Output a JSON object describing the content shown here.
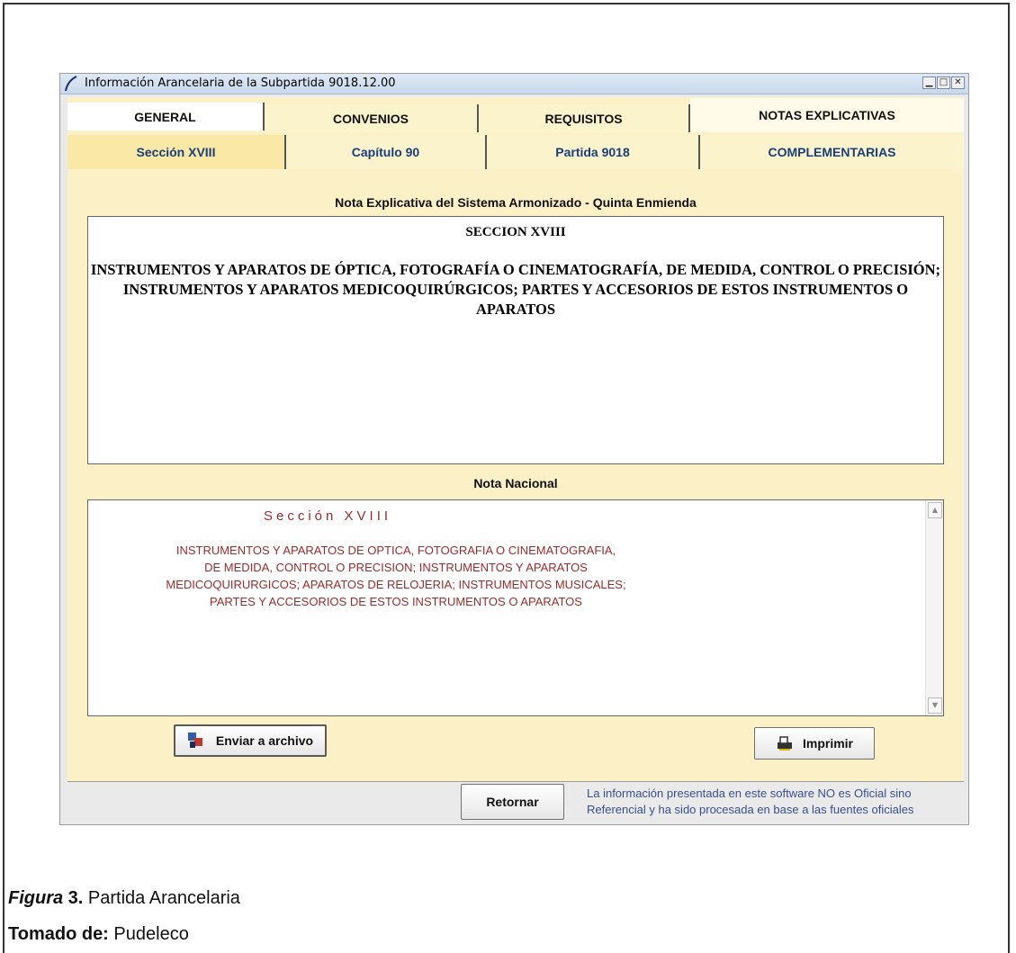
{
  "window": {
    "title": "Información Arancelaria de la Subpartida 9018.12.00",
    "controls": [
      "minimize",
      "maximize",
      "close"
    ]
  },
  "main_tabs": [
    {
      "label": "GENERAL",
      "active": false
    },
    {
      "label": "CONVENIOS",
      "active": false
    },
    {
      "label": "REQUISITOS",
      "active": false
    },
    {
      "label": "NOTAS EXPLICATIVAS",
      "active": true
    }
  ],
  "sub_tabs": [
    {
      "label": "Sección  XVIII",
      "active": true
    },
    {
      "label": "Capítulo  90",
      "active": false
    },
    {
      "label": "Partida  9018",
      "active": false
    },
    {
      "label": "COMPLEMENTARIAS",
      "active": false
    }
  ],
  "explicativa": {
    "header": "Nota Explicativa del Sistema Armonizado - Quinta Enmienda",
    "title": "SECCION XVIII",
    "lines": [
      "INSTRUMENTOS Y APARATOS DE ÓPTICA, FOTOGRAFÍA O CINEMATOGRAFÍA, DE MEDIDA,  CONTROL O PRECISIÓN;",
      "INSTRUMENTOS Y APARATOS MEDICOQUIRÚRGICOS;  PARTES Y ACCESORIOS DE ESTOS INSTRUMENTOS O APARATOS"
    ]
  },
  "nacional": {
    "header": "Nota Nacional",
    "title": "Sección XVIII",
    "lines": [
      "INSTRUMENTOS Y APARATOS DE OPTICA, FOTOGRAFIA O CINEMATOGRAFIA,",
      "DE MEDIDA, CONTROL O PRECISION; INSTRUMENTOS Y APARATOS",
      "MEDICOQUIRURGICOS; APARATOS DE RELOJERIA; INSTRUMENTOS MUSICALES;",
      "PARTES Y ACCESORIOS DE ESTOS INSTRUMENTOS O APARATOS"
    ]
  },
  "buttons": {
    "file": "Enviar a archivo",
    "print": "Imprimir",
    "return": "Retornar"
  },
  "disclaimer": [
    "La información presentada en este software NO es Oficial sino",
    "Referencial y ha sido procesada en base a las fuentes oficiales"
  ],
  "caption": {
    "figure_label": "Figura",
    "figure_number": " 3.",
    "figure_title": " Partida Arancelaria",
    "source_label": "Tomado de:",
    "source": " Pudeleco"
  },
  "colors": {
    "tab_background": "#fbf3cc",
    "active_subtab": "#f9e8a6",
    "nota_nacional_text": "#9a2b2b",
    "disclaimer_text": "#3a4f8a"
  }
}
